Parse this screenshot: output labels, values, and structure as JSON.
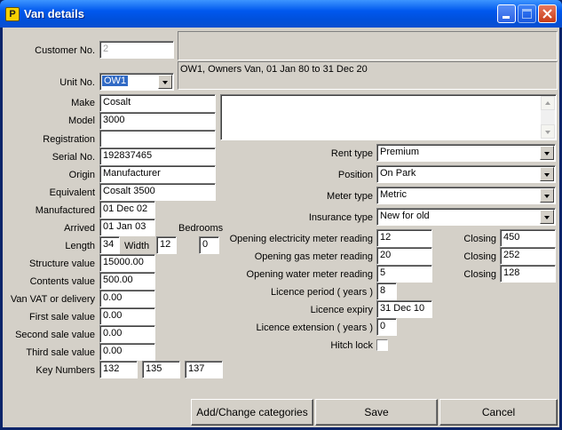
{
  "window": {
    "title": "Van details",
    "app_icon_letter": "P"
  },
  "customer": {
    "label": "Customer No.",
    "value": "2"
  },
  "unit": {
    "label": "Unit No.",
    "selected": "OW1",
    "summary": "OW1, Owners Van, 01 Jan 80 to 31 Dec 20"
  },
  "left_fields": [
    {
      "label": "Make",
      "value": "Cosalt"
    },
    {
      "label": "Model",
      "value": "3000"
    },
    {
      "label": "Registration",
      "value": ""
    },
    {
      "label": "Serial No.",
      "value": "192837465"
    },
    {
      "label": "Origin",
      "value": "Manufacturer"
    },
    {
      "label": "Equivalent",
      "value": "Cosalt 3500"
    },
    {
      "label": "Manufactured",
      "value": "01 Dec 02"
    },
    {
      "label": "Arrived",
      "value": "01 Jan 03"
    }
  ],
  "bedrooms": {
    "label": "Bedrooms",
    "value": "0"
  },
  "length": {
    "label": "Length",
    "value": "34"
  },
  "width": {
    "label": "Width",
    "value": "12"
  },
  "money_fields": [
    {
      "label": "Structure value",
      "value": "15000.00"
    },
    {
      "label": "Contents value",
      "value": "500.00"
    },
    {
      "label": "Van VAT or delivery",
      "value": "0.00"
    },
    {
      "label": "First sale value",
      "value": "0.00"
    },
    {
      "label": "Second sale value",
      "value": "0.00"
    },
    {
      "label": "Third sale value",
      "value": "0.00"
    }
  ],
  "key_numbers": {
    "label": "Key Numbers",
    "values": [
      "132",
      "135",
      "137"
    ]
  },
  "dropdowns": [
    {
      "label": "Rent type",
      "value": "Premium"
    },
    {
      "label": "Position",
      "value": "On Park"
    },
    {
      "label": "Meter type",
      "value": "Metric"
    },
    {
      "label": "Insurance type",
      "value": "New for old"
    }
  ],
  "meters": [
    {
      "label": "Opening electricity meter reading",
      "opening": "12",
      "closing_label": "Closing",
      "closing": "450"
    },
    {
      "label": "Opening gas meter reading",
      "opening": "20",
      "closing_label": "Closing",
      "closing": "252"
    },
    {
      "label": "Opening water meter reading",
      "opening": "5",
      "closing_label": "Closing",
      "closing": "128"
    }
  ],
  "licence": {
    "period_label": "Licence period ( years )",
    "period": "8",
    "expiry_label": "Licence expiry",
    "expiry": "31 Dec 10",
    "extension_label": "Licence extension ( years )",
    "extension": "0"
  },
  "hitch_lock": {
    "label": "Hitch lock",
    "checked": false
  },
  "buttons": {
    "categories": "Add/Change categories",
    "save": "Save",
    "cancel": "Cancel"
  }
}
